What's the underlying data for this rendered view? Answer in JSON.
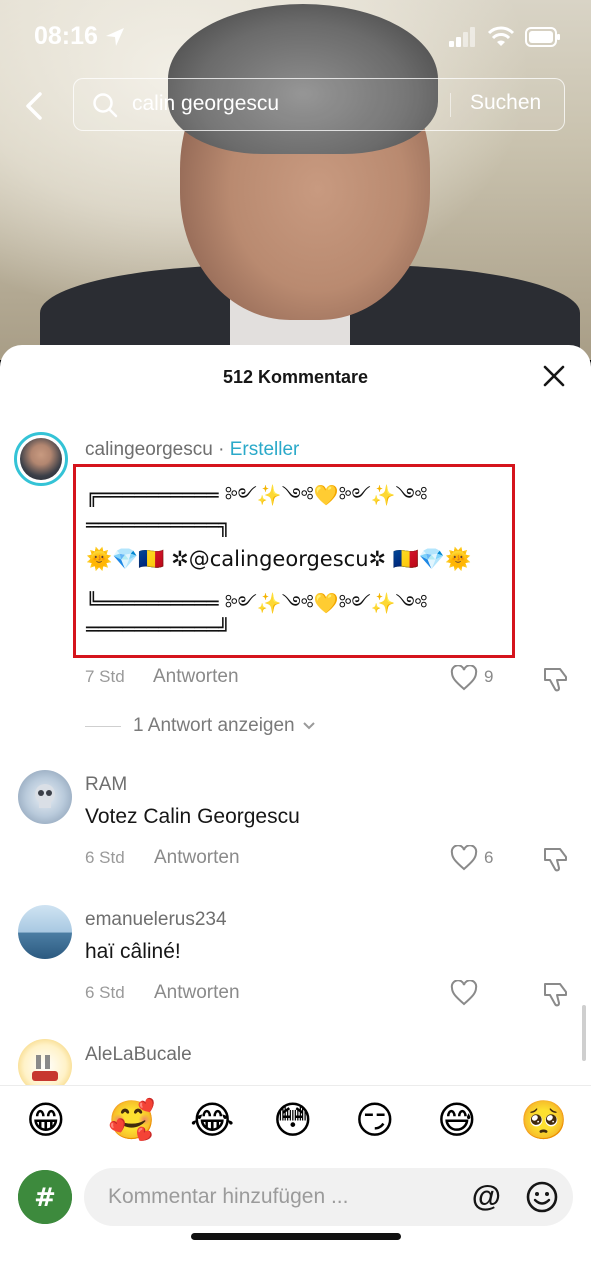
{
  "status_bar": {
    "time": "08:16"
  },
  "search": {
    "query": "calin georgescu",
    "submit_label": "Suchen"
  },
  "comments_sheet": {
    "title": "512 Kommentare",
    "comments": [
      {
        "username": "calingeorgescu",
        "separator": " · ",
        "creator_label": "Ersteller",
        "text_lines": [
          "╔══════════ ༻✨༺💛༻✨༺",
          "═══════════╗",
          "🌞💎🇷🇴 ✲@calingeorgescu✲ 🇷🇴💎🌞",
          "╚══════════ ༻✨༺💛༻✨༺",
          "═══════════╝"
        ],
        "time": "7 Std",
        "reply_label": "Antworten",
        "likes": "9",
        "view_replies_label": "1 Antwort anzeigen"
      },
      {
        "username": "RAM",
        "text": "Votez Calin Georgescu",
        "time": "6 Std",
        "reply_label": "Antworten",
        "likes": "6"
      },
      {
        "username": "emanuelerus234",
        "text": "haï câliné!",
        "time": "6 Std",
        "reply_label": "Antworten",
        "likes": ""
      },
      {
        "username": "AleLaBucale",
        "text": ""
      }
    ]
  },
  "composer": {
    "emojis": [
      "😁",
      "🥰",
      "😂",
      "😳",
      "😏",
      "😅",
      "🥺"
    ],
    "placeholder": "Kommentar hinzufügen ...",
    "at_symbol": "@"
  },
  "colors": {
    "creator_accent": "#2aa9c9",
    "highlight_border": "#d5141c"
  }
}
